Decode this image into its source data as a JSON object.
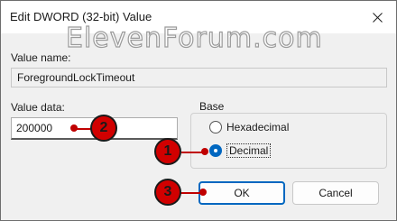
{
  "window": {
    "title": "Edit DWORD (32-bit) Value"
  },
  "watermark": "ElevenForum.com",
  "value_name": {
    "label": "Value name:",
    "value": "ForegroundLockTimeout"
  },
  "value_data": {
    "label": "Value data:",
    "value": "200000"
  },
  "base": {
    "label": "Base",
    "options": [
      {
        "label": "Hexadecimal",
        "checked": false
      },
      {
        "label": "Decimal",
        "checked": true
      }
    ]
  },
  "buttons": {
    "ok": "OK",
    "cancel": "Cancel"
  },
  "markers": [
    "1",
    "2",
    "3"
  ],
  "colors": {
    "accent": "#0067c0",
    "marker": "#d10000"
  }
}
